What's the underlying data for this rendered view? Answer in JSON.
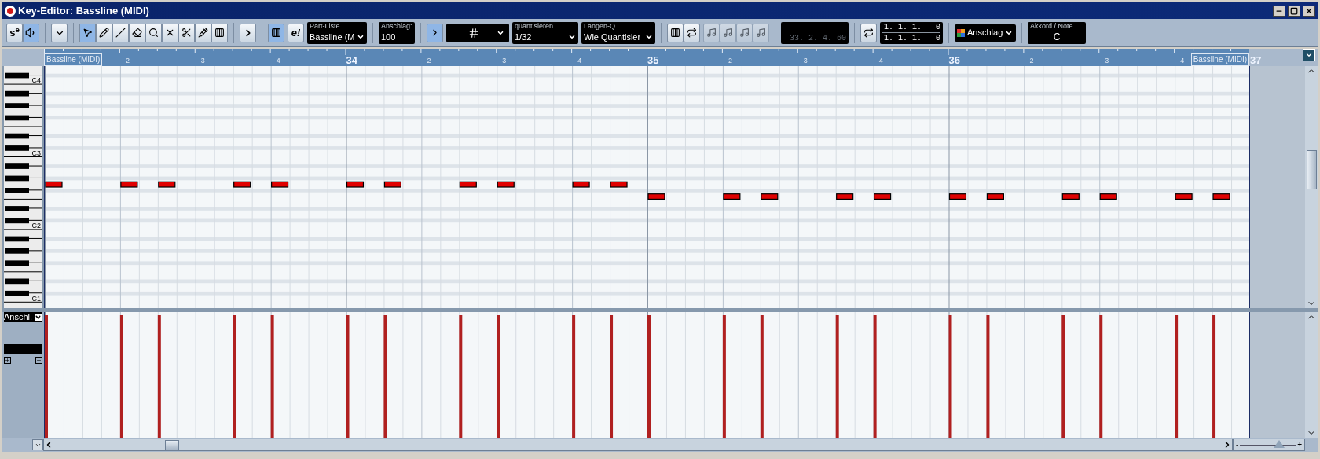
{
  "window": {
    "title": "Key-Editor: Bassline (MIDI)"
  },
  "toolbar": {
    "mode_buttons": [
      {
        "kind": "solo",
        "label": "s$^{e}$",
        "selected": false
      },
      {
        "kind": "speaker",
        "selected": true
      }
    ],
    "tools": [
      {
        "kind": "arrow",
        "selected": true
      },
      {
        "kind": "pencil",
        "selected": false
      },
      {
        "kind": "line",
        "selected": false
      },
      {
        "kind": "eraser",
        "selected": false
      },
      {
        "kind": "zoom",
        "selected": false
      },
      {
        "kind": "mute",
        "selected": false
      },
      {
        "kind": "scissors",
        "selected": false
      },
      {
        "kind": "glue",
        "selected": false
      },
      {
        "kind": "comb",
        "selected": false
      }
    ],
    "autoscroll": {
      "selected": true
    },
    "edit_button": {
      "label": "e!",
      "selected": false
    },
    "part_list": {
      "label": "Part-Liste",
      "value": "Bassline (M"
    },
    "velocity": {
      "label": "Anschlag:",
      "value": "100"
    },
    "snap": {
      "selected": true
    },
    "quantize": {
      "label": "quantisieren",
      "value": "1/32"
    },
    "length_q": {
      "label": "Längen-Q",
      "value": "Wie Quantisier"
    },
    "position": "33. 2. 4. 60",
    "locators": [
      "1. 1. 1.   0",
      "1. 1. 1.   0"
    ],
    "color_menu": {
      "value": "Anschlag"
    },
    "chord": {
      "label": "Akkord / Note",
      "value": "C"
    }
  },
  "ruler": {
    "parts": [
      "Bassline (MIDI)",
      "Bassline (MIDI)"
    ],
    "marks": [
      {
        "text": "2",
        "kind": "beat"
      },
      {
        "text": "3",
        "kind": "beat"
      },
      {
        "text": "4",
        "kind": "beat"
      },
      {
        "text": "34",
        "kind": "bar"
      },
      {
        "text": "2",
        "kind": "beat"
      },
      {
        "text": "3",
        "kind": "beat"
      },
      {
        "text": "4",
        "kind": "beat"
      },
      {
        "text": "35",
        "kind": "bar"
      },
      {
        "text": "2",
        "kind": "beat"
      },
      {
        "text": "3",
        "kind": "beat"
      },
      {
        "text": "4",
        "kind": "beat"
      },
      {
        "text": "36",
        "kind": "bar"
      },
      {
        "text": "2",
        "kind": "beat"
      },
      {
        "text": "3",
        "kind": "beat"
      },
      {
        "text": "4",
        "kind": "beat"
      },
      {
        "text": "37",
        "kind": "bar"
      }
    ]
  },
  "keyboard": {
    "labels": [
      "C4",
      "C3",
      "C2",
      "C1"
    ]
  },
  "controller": {
    "lane": "Anschl."
  },
  "zoom_slider": {
    "minus": "-",
    "plus": "+",
    "level": 0.7
  }
}
